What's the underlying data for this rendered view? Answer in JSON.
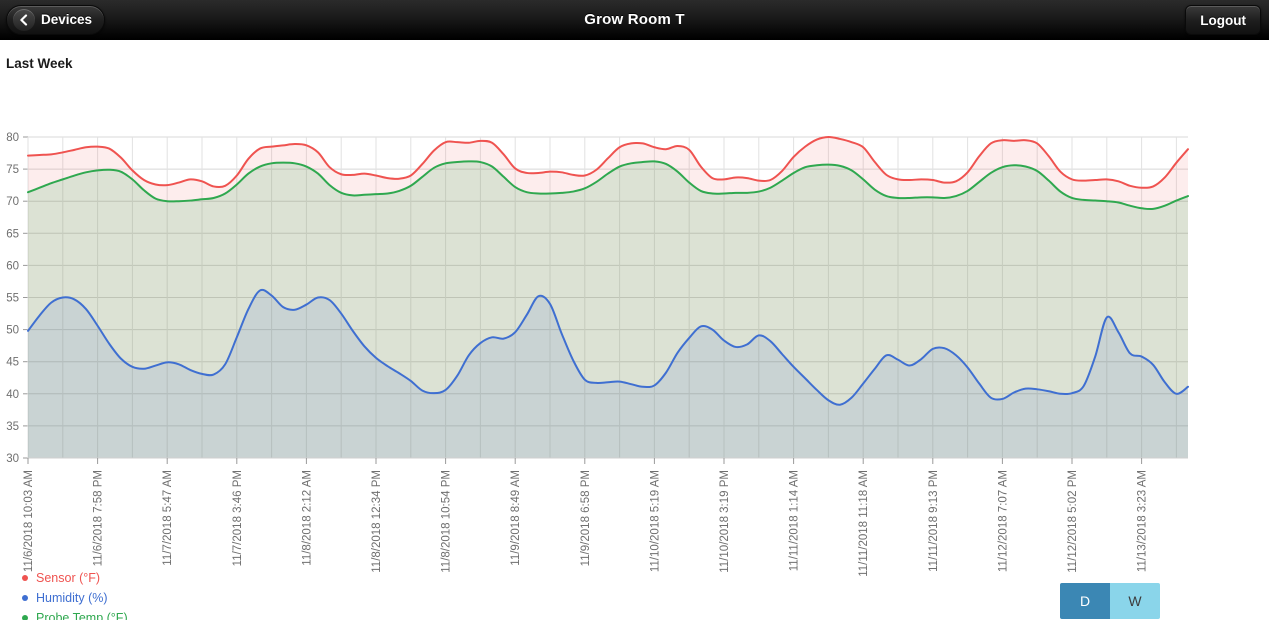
{
  "header": {
    "back_label": "Devices",
    "back_icon": "chevron-left-icon",
    "title": "Grow Room T",
    "logout_label": "Logout"
  },
  "main": {
    "section_title": "Last Week"
  },
  "legend": [
    {
      "label": "Sensor (°F)",
      "color": "#ef5350"
    },
    {
      "label": "Humidity (%)",
      "color": "#3f6fd1"
    },
    {
      "label": "Probe Temp (°F)",
      "color": "#2fa84f"
    }
  ],
  "range_toggle": {
    "options": [
      {
        "label": "D",
        "selected": true
      },
      {
        "label": "W",
        "selected": false
      }
    ]
  },
  "chart_data": {
    "type": "line",
    "title": "Last Week",
    "xlabel": "",
    "ylabel": "",
    "ylim": [
      30,
      80
    ],
    "yticks": [
      80,
      75,
      70,
      65,
      60,
      55,
      50,
      45,
      40,
      35,
      30
    ],
    "grid": true,
    "legend_position": "bottom-left",
    "fill": true,
    "x_tick_labels": [
      "11/6/2018 10:03 AM",
      "11/6/2018 7:58 PM",
      "11/7/2018 5:47 AM",
      "11/7/2018 3:46 PM",
      "11/8/2018 2:12 AM",
      "11/8/2018 12:34 PM",
      "11/8/2018 10:54 PM",
      "11/9/2018 8:49 AM",
      "11/9/2018 6:58 PM",
      "11/10/2018 5:19 AM",
      "11/10/2018 3:19 PM",
      "11/11/2018 1:14 AM",
      "11/11/2018 11:18 AM",
      "11/11/2018 9:13 PM",
      "11/12/2018 7:07 AM",
      "11/12/2018 5:02 PM",
      "11/13/2018 3:23 AM"
    ],
    "x_tick_index": [
      0,
      6,
      12,
      18,
      24,
      30,
      36,
      42,
      48,
      54,
      60,
      66,
      72,
      78,
      84,
      90,
      96
    ],
    "n_points": 101,
    "series": [
      {
        "name": "Sensor (°F)",
        "color": "#ef5350",
        "fill_color": "rgba(239,83,80,0.10)",
        "unit": "°F",
        "values": [
          77.1,
          77.2,
          77.3,
          77.6,
          78.0,
          78.4,
          78.5,
          78.2,
          76.8,
          74.8,
          73.3,
          72.6,
          72.5,
          72.9,
          73.4,
          73.1,
          72.3,
          72.4,
          74.0,
          76.6,
          78.2,
          78.5,
          78.7,
          78.9,
          78.7,
          77.6,
          75.3,
          74.2,
          74.1,
          74.3,
          74.0,
          73.6,
          73.5,
          74.0,
          75.8,
          77.9,
          79.2,
          79.2,
          79.1,
          79.4,
          79.1,
          77.3,
          75.1,
          74.4,
          74.4,
          74.6,
          74.5,
          74.1,
          74.0,
          74.9,
          76.7,
          78.4,
          79.0,
          79.0,
          78.4,
          78.1,
          78.6,
          78.0,
          75.4,
          73.6,
          73.4,
          73.7,
          73.6,
          73.2,
          73.3,
          74.7,
          76.9,
          78.5,
          79.6,
          80.0,
          79.7,
          79.2,
          78.4,
          76.1,
          74.1,
          73.4,
          73.3,
          73.4,
          73.3,
          72.9,
          73.1,
          74.5,
          77.0,
          79.0,
          79.5,
          79.4,
          79.5,
          79.0,
          77.0,
          74.6,
          73.4,
          73.2,
          73.3,
          73.4,
          73.1,
          72.4,
          72.1,
          72.3,
          73.7,
          76.0,
          78.1
        ]
      },
      {
        "name": "Probe Temp (°F)",
        "color": "#2fa84f",
        "fill_color": "rgba(47,168,79,0.16)",
        "unit": "°F",
        "values": [
          71.4,
          72.1,
          72.8,
          73.4,
          74.0,
          74.5,
          74.8,
          74.9,
          74.6,
          73.4,
          71.7,
          70.4,
          70.0,
          70.0,
          70.1,
          70.3,
          70.5,
          71.2,
          72.6,
          74.3,
          75.4,
          75.9,
          76.0,
          75.9,
          75.4,
          74.3,
          72.5,
          71.3,
          70.9,
          71.0,
          71.1,
          71.2,
          71.6,
          72.4,
          73.8,
          75.2,
          75.9,
          76.1,
          76.2,
          76.1,
          75.4,
          73.8,
          72.2,
          71.4,
          71.2,
          71.2,
          71.3,
          71.5,
          72.0,
          73.0,
          74.3,
          75.4,
          75.9,
          76.1,
          76.2,
          75.8,
          74.6,
          72.9,
          71.6,
          71.2,
          71.2,
          71.3,
          71.3,
          71.5,
          72.1,
          73.2,
          74.4,
          75.3,
          75.6,
          75.7,
          75.5,
          74.8,
          73.4,
          71.8,
          70.8,
          70.5,
          70.5,
          70.6,
          70.6,
          70.5,
          70.8,
          71.6,
          73.0,
          74.4,
          75.3,
          75.6,
          75.4,
          74.7,
          73.2,
          71.5,
          70.5,
          70.2,
          70.1,
          70.0,
          69.8,
          69.3,
          68.9,
          68.8,
          69.3,
          70.1,
          70.8
        ]
      },
      {
        "name": "Humidity (%)",
        "color": "#3f6fd1",
        "fill_color": "rgba(63,111,209,0.12)",
        "unit": "%",
        "values": [
          49.8,
          52.2,
          54.2,
          55.0,
          54.7,
          53.2,
          50.6,
          47.8,
          45.5,
          44.2,
          43.9,
          44.4,
          44.9,
          44.6,
          43.7,
          43.1,
          43.0,
          44.6,
          48.8,
          53.2,
          56.1,
          55.3,
          53.5,
          53.1,
          53.9,
          55.0,
          54.6,
          52.5,
          49.8,
          47.4,
          45.6,
          44.3,
          43.2,
          42.0,
          40.5,
          40.1,
          40.6,
          42.8,
          46.0,
          47.9,
          48.8,
          48.6,
          49.6,
          52.3,
          55.2,
          54.0,
          49.4,
          45.2,
          42.2,
          41.7,
          41.8,
          41.9,
          41.5,
          41.1,
          41.3,
          43.3,
          46.4,
          48.7,
          50.5,
          50.0,
          48.3,
          47.3,
          47.7,
          49.1,
          48.2,
          46.2,
          44.2,
          42.4,
          40.6,
          39.0,
          38.3,
          39.4,
          41.6,
          43.9,
          46.0,
          45.3,
          44.4,
          45.4,
          47.0,
          47.1,
          46.0,
          44.1,
          41.6,
          39.4,
          39.2,
          40.2,
          40.8,
          40.7,
          40.4,
          40.0,
          40.1,
          41.2,
          45.8,
          51.9,
          49.6,
          46.3,
          45.8,
          44.5,
          41.8,
          40.0,
          41.1
        ]
      }
    ]
  }
}
